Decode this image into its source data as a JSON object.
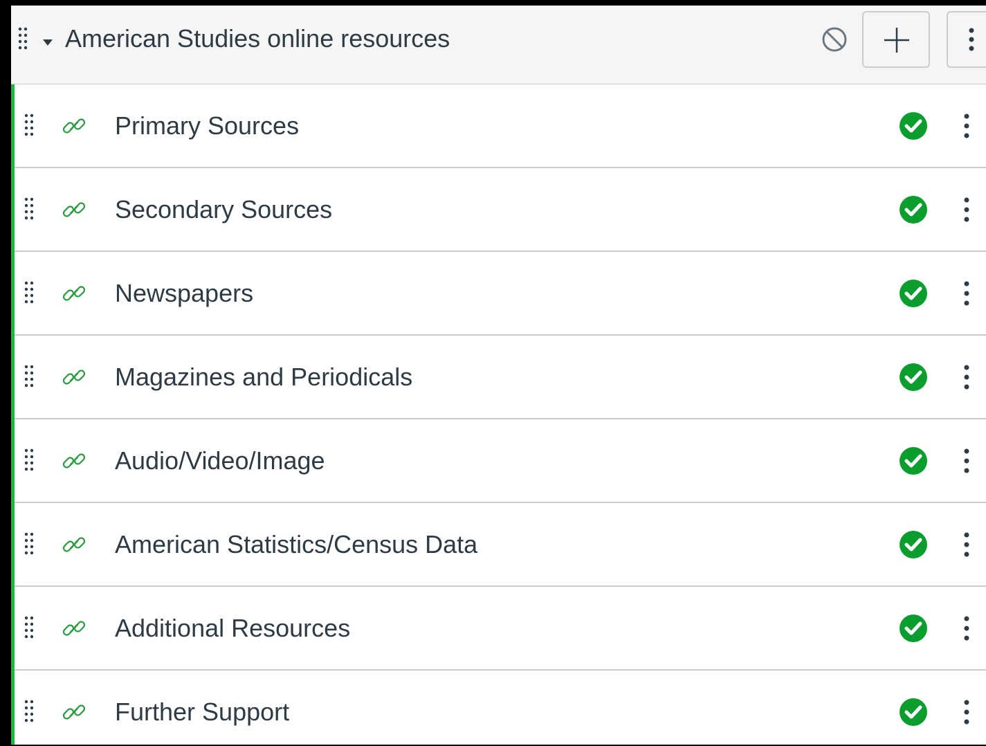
{
  "module": {
    "title": "American Studies online resources",
    "icons": {
      "drag": "drag-handle-icon",
      "caret": "caret-down-icon",
      "unpublished": "unpublished-icon",
      "add": "plus-icon",
      "menu": "kebab-menu-icon"
    }
  },
  "items": [
    {
      "title": "Primary Sources",
      "type": "link",
      "published": true
    },
    {
      "title": "Secondary Sources",
      "type": "link",
      "published": true
    },
    {
      "title": "Newspapers",
      "type": "link",
      "published": true
    },
    {
      "title": "Magazines and Periodicals",
      "type": "link",
      "published": true
    },
    {
      "title": "Audio/Video/Image",
      "type": "link",
      "published": true
    },
    {
      "title": "American Statistics/Census Data",
      "type": "link",
      "published": true
    },
    {
      "title": "Additional Resources",
      "type": "link",
      "published": true
    },
    {
      "title": "Further Support",
      "type": "link",
      "published": true
    }
  ],
  "colors": {
    "published_green": "#0b9e2f",
    "module_border": "#1fb53e",
    "text": "#2d3b45",
    "link_icon": "#2a9b3f"
  }
}
